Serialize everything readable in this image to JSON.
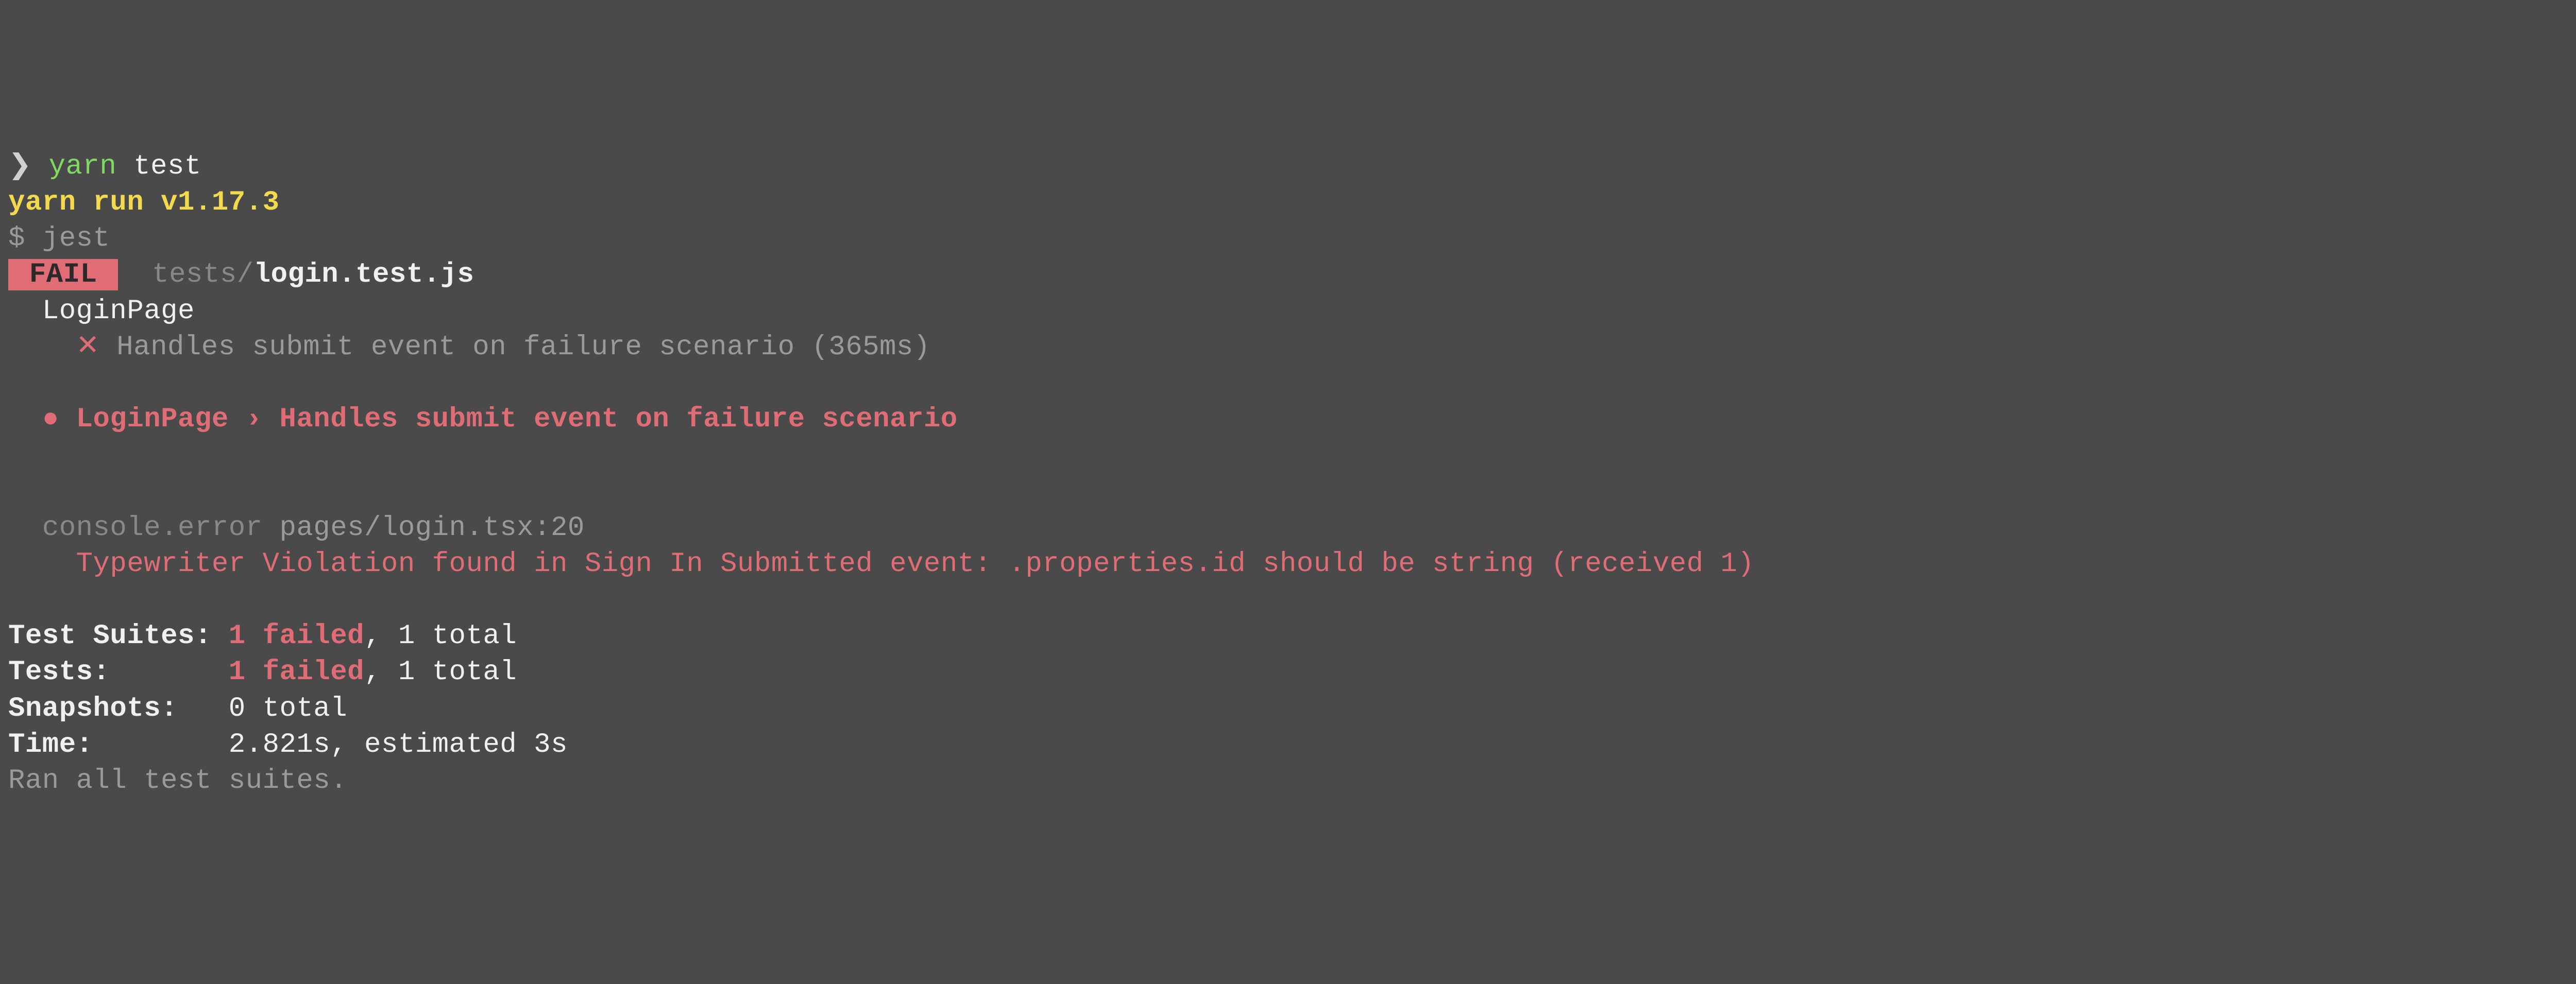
{
  "prompt": {
    "caret": "❯",
    "cmd_name": "yarn",
    "cmd_args": "test"
  },
  "yarn_line": "yarn run v1.17.3",
  "jest_line": "$ jest",
  "fail": {
    "badge": " FAIL ",
    "path_dim": "tests/",
    "path_bold": "login.test.js"
  },
  "suite": {
    "name": "LoginPage",
    "fail_x": "✕",
    "fail_test": "Handles submit event on failure scenario",
    "fail_time": "(365ms)"
  },
  "bullet": {
    "dot": "●",
    "text": "LoginPage › Handles submit event on failure scenario"
  },
  "console": {
    "label": "console.error",
    "location": "pages/login.tsx:20",
    "message": "Typewriter Violation found in Sign In Submitted event: .properties.id should be string (received 1)"
  },
  "summary": {
    "suites_label": "Test Suites:",
    "suites_fail": "1 failed",
    "suites_rest": ", 1 total",
    "tests_label": "Tests:",
    "tests_fail": "1 failed",
    "tests_rest": ", 1 total",
    "snapshots_label": "Snapshots:",
    "snapshots_val": "0 total",
    "time_label": "Time:",
    "time_val": "2.821s, estimated 3s",
    "ran": "Ran all test suites."
  }
}
